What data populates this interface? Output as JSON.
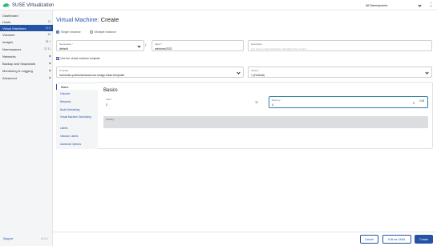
{
  "header": {
    "brand": "SUSE Virtualization",
    "namespace_select": "All Namespaces"
  },
  "sidebar": {
    "items": [
      {
        "label": "Dashboard",
        "badge": ""
      },
      {
        "label": "Hosts",
        "badge": "15"
      },
      {
        "label": "Virtual Machines",
        "badge": "10 6"
      },
      {
        "label": "Volumes",
        "badge": "46"
      },
      {
        "label": "Images",
        "badge": "35 1"
      },
      {
        "label": "Namespaces",
        "badge": "37 11"
      },
      {
        "label": "Networks",
        "badge": ""
      },
      {
        "label": "Backup and Snapshots",
        "badge": ""
      },
      {
        "label": "Monitoring & Logging",
        "badge": ""
      },
      {
        "label": "Advanced",
        "badge": ""
      }
    ],
    "support": "Support",
    "version": "v1.5.0"
  },
  "page": {
    "crumb": "Virtual Machine:",
    "action": "Create"
  },
  "instance_mode": {
    "single": "Single Instance",
    "multiple": "Multiple Instance"
  },
  "form": {
    "namespace_label": "Namespace",
    "namespace_value": "default",
    "name_label": "Name",
    "name_value": "windows2021",
    "description_label": "Description",
    "description_placeholder": "Any text you want that better describes this resource",
    "use_template_label": "Use the virtual machine template",
    "template_label": "Template",
    "template_value": "harvester-public/windows-iso-image-base-template",
    "version_label": "Version",
    "version_value": "1 (Default)"
  },
  "tabs": [
    "Basics",
    "Volumes",
    "Networks",
    "Node Scheduling",
    "Virtual Machine Scheduling",
    "Labels",
    "Instance Labels",
    "Advanced Options"
  ],
  "basics": {
    "section_title": "Basics",
    "cpu_label": "CPU",
    "cpu_value": "2",
    "memory_label": "Memory",
    "memory_value": "4",
    "memory_unit": "GiB",
    "ssh_label": "SSHKey"
  },
  "footer": {
    "cancel": "Cancel",
    "edit_yaml": "Edit as YAML",
    "create": "Create"
  },
  "colors": {
    "accent": "#2453a6",
    "focus": "#2e7ea6"
  }
}
